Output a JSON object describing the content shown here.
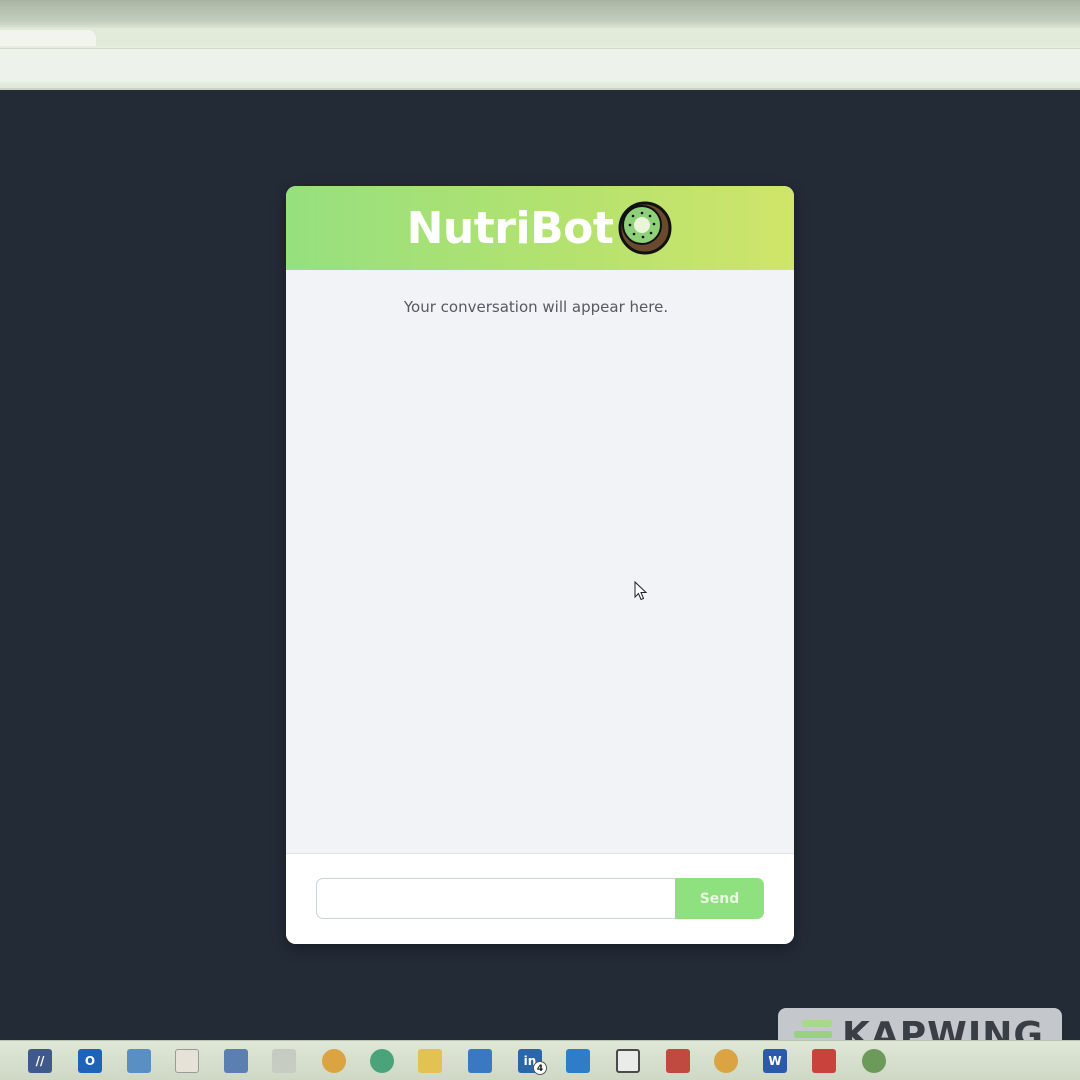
{
  "chatbot": {
    "title": "NutriBot",
    "logo_icon": "kiwi-icon",
    "empty_state": "Your conversation will appear here.",
    "input_value": "",
    "input_placeholder": "",
    "send_label": "Send"
  },
  "watermark": {
    "text": "KAPWING"
  },
  "taskbar": {
    "linkedin_badge": "4"
  },
  "colors": {
    "header_gradient_start": "#96e07f",
    "header_gradient_end": "#d0e56a",
    "send_button": "#8fe07e",
    "page_background": "#232b37",
    "chat_background": "#f1f3f6"
  }
}
